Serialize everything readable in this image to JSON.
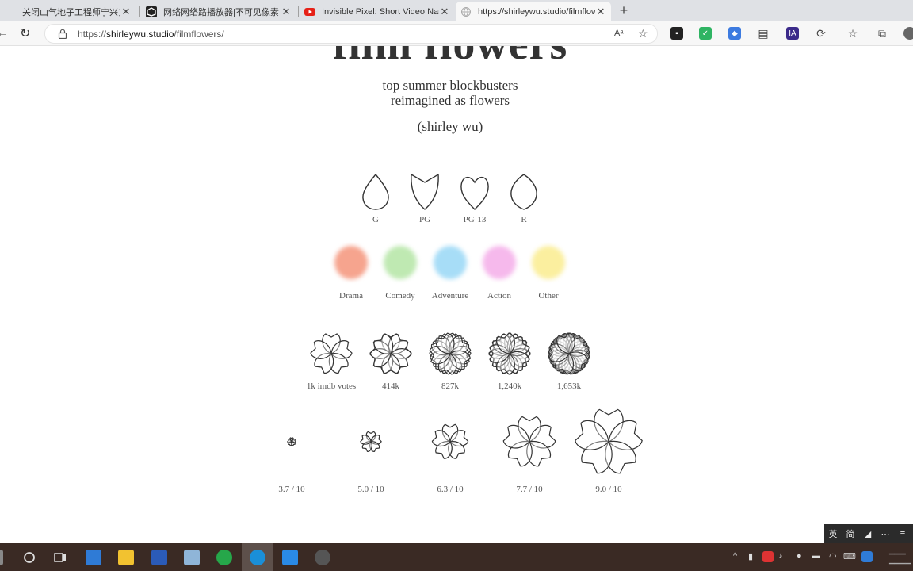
{
  "browser": {
    "tabs": [
      {
        "title": "关闭山气地子工程师宁兴贷萨克"
      },
      {
        "title": "网络网络路播放器|不可见像素"
      },
      {
        "title": "Invisible Pixel: Short Video Nar"
      },
      {
        "title": "https://shirleywu.studio/filmflow"
      }
    ],
    "new_tab": "+",
    "minimize": "—",
    "url_scheme": "https://",
    "url_host": "shirleywu.studio",
    "url_path": "/filmflowers/",
    "read_aloud": "Aᵃ"
  },
  "page": {
    "title": "film flowers",
    "subtitle_line1": "top summer blockbusters",
    "subtitle_line2": "reimagined as flowers",
    "author_open": "(",
    "author_name": "shirley wu",
    "author_close": ")",
    "petal_legend": [
      {
        "label": "G"
      },
      {
        "label": "PG"
      },
      {
        "label": "PG-13"
      },
      {
        "label": "R"
      }
    ],
    "genre_legend": [
      {
        "label": "Drama",
        "color": "#f6a48e"
      },
      {
        "label": "Comedy",
        "color": "#bfe9b2"
      },
      {
        "label": "Adventure",
        "color": "#a7ddf7"
      },
      {
        "label": "Action",
        "color": "#f6b9ec"
      },
      {
        "label": "Other",
        "color": "#fbef9f"
      }
    ],
    "votes_legend": [
      {
        "label": "1k imdb votes",
        "petal_layers": 1
      },
      {
        "label": "414k",
        "petal_layers": 2
      },
      {
        "label": "827k",
        "petal_layers": 3
      },
      {
        "label": "1,240k",
        "petal_layers": 4
      },
      {
        "label": "1,653k",
        "petal_layers": 5
      }
    ],
    "rating_legend": [
      {
        "label": "3.7 / 10",
        "rating": 3.7
      },
      {
        "label": "5.0 / 10",
        "rating": 5.0
      },
      {
        "label": "6.3 / 10",
        "rating": 6.3
      },
      {
        "label": "7.7 / 10",
        "rating": 7.7
      },
      {
        "label": "9.0 / 10",
        "rating": 9.0
      }
    ]
  },
  "ime": {
    "lang": "英",
    "mode": "简"
  }
}
